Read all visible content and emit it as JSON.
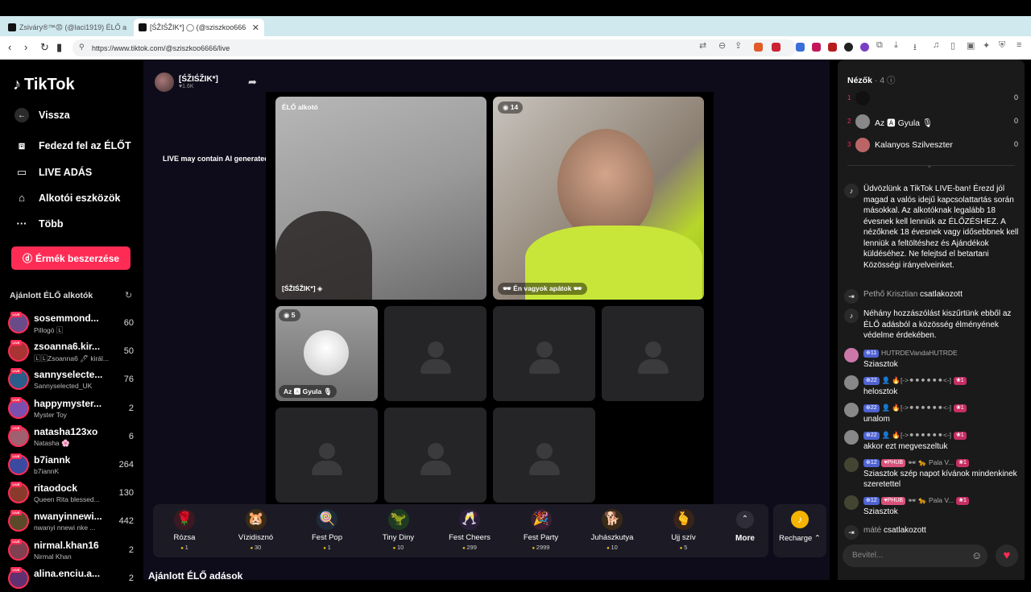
{
  "browser": {
    "tabs": [
      {
        "label": "Zsiváry®™😡 (@laci1919) ÉLŐ a",
        "active": false
      },
      {
        "label": "[ŚŽIŚŽIK*] ◯ (@sziszkoo666",
        "active": true
      }
    ],
    "url": "https://www.tiktok.com/@sziszkoo6666/live",
    "new_tab": "+"
  },
  "sidebar": {
    "logo": "TikTok",
    "back": "Vissza",
    "nav": [
      {
        "label": "Fedezd fel az ÉLŐT",
        "icon": "explore-icon"
      },
      {
        "label": "LIVE ADÁS",
        "icon": "camera-icon"
      },
      {
        "label": "Alkotói eszközök",
        "icon": "tools-icon"
      },
      {
        "label": "Több",
        "icon": "more-icon"
      }
    ],
    "coins_button": "Érmék beszerzése",
    "recommended_title": "Ajánlott ÉLŐ alkotók",
    "live_badge": "LIVE",
    "creators": [
      {
        "name": "sosemmond...",
        "sub": "Pillogó 🄻",
        "count": "60",
        "color": "#6a4b8a"
      },
      {
        "name": "zsoanna6.kir...",
        "sub": "🄻🄻Zsoanna6 🖊 királ...",
        "count": "50",
        "color": "#a33"
      },
      {
        "name": "sannyselecte...",
        "sub": "Sannyselected_UK",
        "count": "76",
        "color": "#2a5d8a"
      },
      {
        "name": "happymyster...",
        "sub": "Myster Toy",
        "count": "2",
        "color": "#7a4fb0"
      },
      {
        "name": "natasha123xo",
        "sub": "Natasha 🌸",
        "count": "6",
        "color": "#a06070"
      },
      {
        "name": "b7iannk",
        "sub": "b7iannK",
        "count": "264",
        "color": "#3a4aa0"
      },
      {
        "name": "ritaodock",
        "sub": "Queen Rita blessed...",
        "count": "130",
        "color": "#8a3a2a"
      },
      {
        "name": "nwanyinnewi...",
        "sub": "nwanyi nnewi nke ...",
        "count": "442",
        "color": "#5a4a2a"
      },
      {
        "name": "nirmal.khan16",
        "sub": "Nirmal Khan",
        "count": "2",
        "color": "#804050"
      },
      {
        "name": "alina.enciu.a...",
        "sub": "",
        "count": "2",
        "color": "#603070"
      }
    ]
  },
  "stream": {
    "host_name": "[ŚŽIŚŽIK*]",
    "host_likes": "♥1.6K",
    "ai_note": "LIVE may contain AI generated content",
    "tiles": {
      "host_label": "ÉLŐ alkotó",
      "host_bottom": "[ŚŽIŚŽIK*] ◈",
      "guest1_count": "14",
      "guest1_name": "🕶 Én vagyok apátok 🕶",
      "guest2_count": "5",
      "guest2_name": "Az 🅰 Gyula 🎙"
    },
    "gifts": [
      {
        "name": "Rózsa",
        "price": "1",
        "icon": "🌹",
        "bg": "#3a1a22"
      },
      {
        "name": "Vízidisznó",
        "price": "30",
        "icon": "🐹",
        "bg": "#3a2a18"
      },
      {
        "name": "Fest Pop",
        "price": "1",
        "icon": "🍭",
        "bg": "#1f2a3a"
      },
      {
        "name": "Tiny Diny",
        "price": "10",
        "icon": "🦖",
        "bg": "#1f3a22"
      },
      {
        "name": "Fest Cheers",
        "price": "299",
        "icon": "🥂",
        "bg": "#2a1f3a"
      },
      {
        "name": "Fest Party",
        "price": "2999",
        "icon": "🎉",
        "bg": "#3a1f35"
      },
      {
        "name": "Juhászkutya",
        "price": "10",
        "icon": "🐕",
        "bg": "#3a2a18"
      },
      {
        "name": "Ujj szív",
        "price": "5",
        "icon": "🫰",
        "bg": "#3a2418"
      }
    ],
    "more_label": "More",
    "recharge_label": "Recharge ⌃",
    "recommended_live": "Ajánlott ÉLŐ adások"
  },
  "viewers": {
    "title": "Nézők",
    "count": "· 4",
    "rows": [
      {
        "rank": "1",
        "name": "",
        "score": "0",
        "color": "#111"
      },
      {
        "rank": "2",
        "name": "Az 🅰 Gyula 🎙",
        "score": "0",
        "color": "#888"
      },
      {
        "rank": "3",
        "name": "Kalanyos Szilveszter",
        "score": "0",
        "color": "#b66"
      }
    ]
  },
  "chat": {
    "welcome": "Üdvözlünk a TikTok LIVE-ban! Érezd jól magad a valós idejű kapcsolattartás során másokkal. Az alkotóknak legalább 18 évesnek kell lenniük az ÉLŐZÉSHEZ. A nézőknek 18 évesnek vagy idősebbnek kell lenniük a feltöltéshez és Ajándékok küldéséhez. Ne felejtsd el betartani Közösségi irányelveinket.",
    "join1_name": "Pethő Krisztian",
    "join1_text": "csatlakozott",
    "filter_note": "Néhány hozzászólást kiszűrtünk ebből az ÉLŐ adásból a közösség élményének védelme érdekében.",
    "m1_level": "11",
    "m1_name": "HUTRDEVandaHUTRDE",
    "m1_text": "Sziasztok",
    "m2_level": "22",
    "m2_name": "👤 🔥[->⚫⚫⚫⚫⚫⚫<-]",
    "m2_badge": "1",
    "m2_text": "helosztok",
    "m3_level": "22",
    "m3_name": "👤 🔥[->⚫⚫⚫⚫⚫⚫<-]",
    "m3_badge": "1",
    "m3_text": "unalom",
    "m4_level": "22",
    "m4_name": "👤 🔥[->⚫⚫⚫⚫⚫⚫<-]",
    "m4_badge": "1",
    "m4_text": "akkor ezt megveszeltuk",
    "m5_level": "12",
    "m5_fan": "PHUB",
    "m5_name": "🕶 🐆 Pala V...",
    "m5_badge": "1",
    "m5_text": "Sziasztok szép napot kívánok mindenkinek szeretettel",
    "m6_level": "12",
    "m6_fan": "PHUB",
    "m6_name": "🕶 🐆 Pala V...",
    "m6_badge": "1",
    "m6_text": "Sziasztok",
    "join2_name": "máté",
    "join2_text": "csatlakozott",
    "input_placeholder": "Bevitel..."
  }
}
